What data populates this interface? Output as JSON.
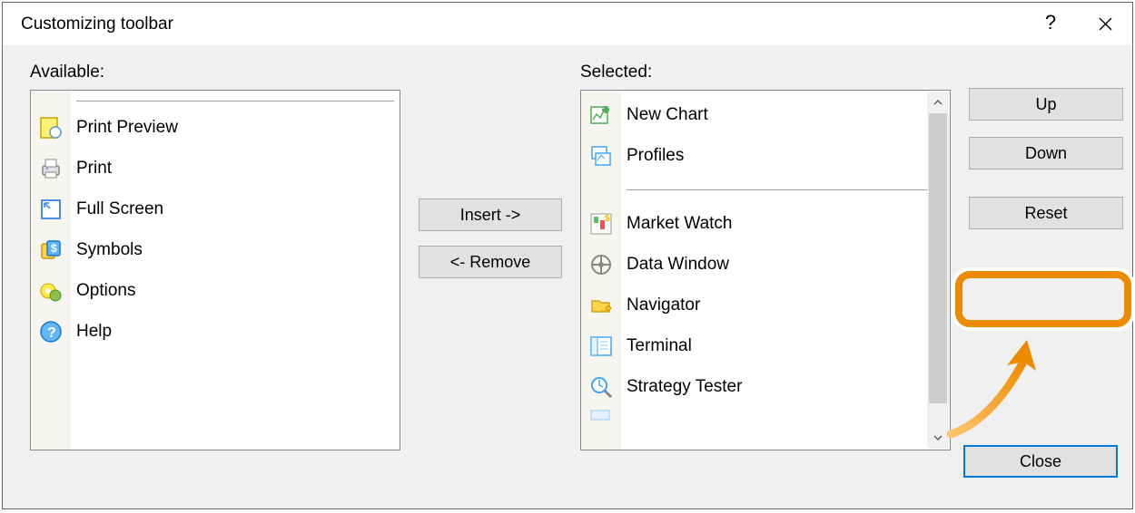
{
  "title": "Customizing toolbar",
  "labels": {
    "available": "Available:",
    "selected": "Selected:"
  },
  "available": {
    "items": [
      {
        "label": "Print Preview",
        "icon": "print-preview-icon"
      },
      {
        "label": "Print",
        "icon": "print-icon"
      },
      {
        "label": "Full Screen",
        "icon": "fullscreen-icon"
      },
      {
        "label": "Symbols",
        "icon": "symbols-icon"
      },
      {
        "label": "Options",
        "icon": "options-icon"
      },
      {
        "label": "Help",
        "icon": "help-icon"
      }
    ]
  },
  "selected": {
    "items": [
      {
        "label": "New Chart",
        "icon": "new-chart-icon"
      },
      {
        "label": "Profiles",
        "icon": "profiles-icon"
      },
      {
        "separator": true
      },
      {
        "label": "Market Watch",
        "icon": "market-watch-icon"
      },
      {
        "label": "Data Window",
        "icon": "data-window-icon"
      },
      {
        "label": "Navigator",
        "icon": "navigator-icon"
      },
      {
        "label": "Terminal",
        "icon": "terminal-icon"
      },
      {
        "label": "Strategy Tester",
        "icon": "strategy-tester-icon"
      }
    ]
  },
  "buttons": {
    "insert": "Insert ->",
    "remove": "<- Remove",
    "up": "Up",
    "down": "Down",
    "reset": "Reset",
    "close": "Close"
  }
}
